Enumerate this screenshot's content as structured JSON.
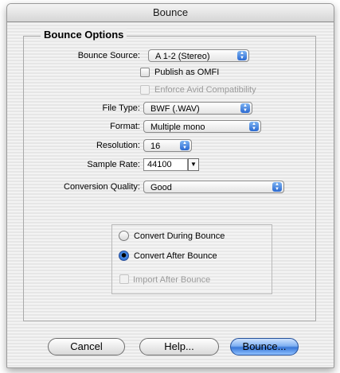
{
  "window": {
    "title": "Bounce"
  },
  "group": {
    "label": "Bounce Options"
  },
  "fields": {
    "bounce_source": {
      "label": "Bounce Source:",
      "value": "A 1-2 (Stereo)"
    },
    "publish_omfi": {
      "label": "Publish as OMFI",
      "checked": false
    },
    "enforce_avid": {
      "label": "Enforce Avid Compatibility",
      "checked": false,
      "disabled": true
    },
    "file_type": {
      "label": "File Type:",
      "value": "BWF (.WAV)"
    },
    "format": {
      "label": "Format:",
      "value": "Multiple mono"
    },
    "resolution": {
      "label": "Resolution:",
      "value": "16"
    },
    "sample_rate": {
      "label": "Sample Rate:",
      "value": "44100"
    },
    "conversion_quality": {
      "label": "Conversion Quality:",
      "value": "Good"
    }
  },
  "conversion": {
    "during_label": "Convert During Bounce",
    "after_label": "Convert After Bounce",
    "selected": "after",
    "import_after_label": "Import After Bounce"
  },
  "buttons": {
    "cancel": "Cancel",
    "help": "Help...",
    "bounce": "Bounce..."
  }
}
